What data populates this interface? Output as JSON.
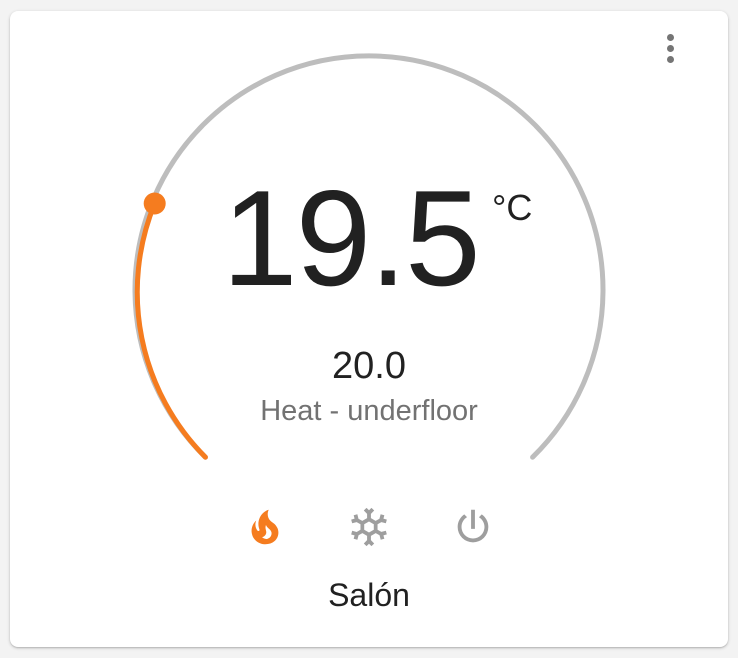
{
  "thermostat": {
    "current_temperature": "19.5",
    "unit": "°C",
    "target_temperature": "20.0",
    "mode_label": "Heat - underfloor",
    "name": "Salón"
  },
  "modes": [
    {
      "name": "heat",
      "active": true
    },
    {
      "name": "cool",
      "active": false
    },
    {
      "name": "off",
      "active": false
    }
  ],
  "colors": {
    "accent_heat": "#f57c1f",
    "track": "#bdbdbd",
    "inactive_icon": "#9e9e9e",
    "text_primary": "#212121",
    "text_secondary": "#727272"
  },
  "icons": {
    "menu": "dots-vertical-icon",
    "heat": "fire-icon",
    "cool": "snowflake-icon",
    "off": "power-icon"
  }
}
